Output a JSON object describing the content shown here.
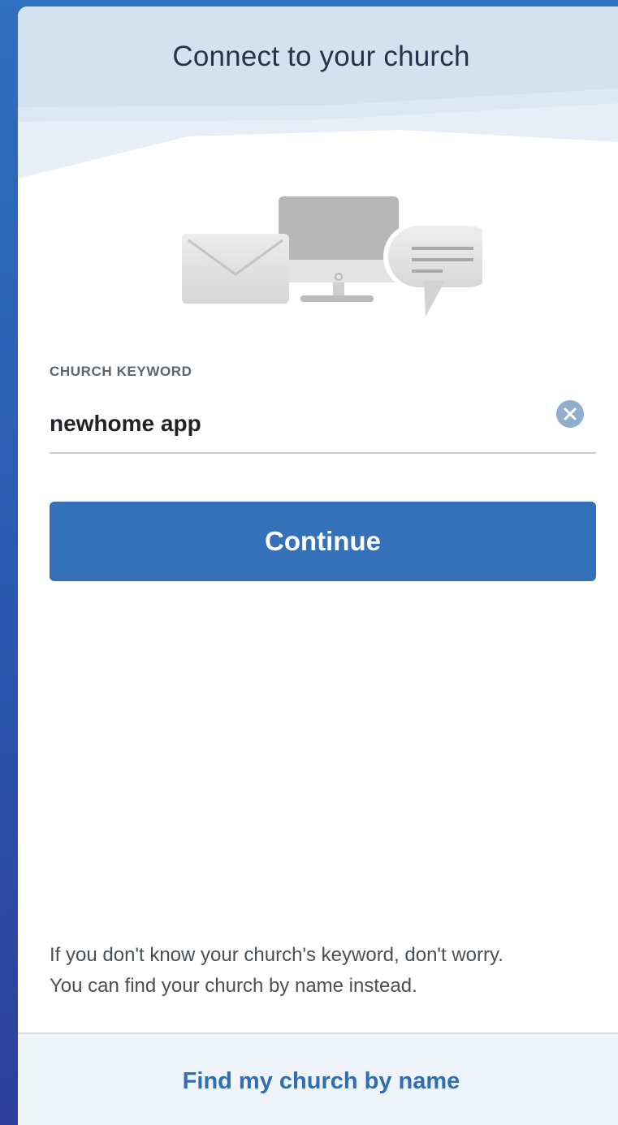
{
  "header": {
    "title": "Connect to your church"
  },
  "illustration": {
    "icons": [
      "envelope-icon",
      "monitor-icon",
      "chat-bubble-icon"
    ]
  },
  "keyword_field": {
    "label": "CHURCH KEYWORD",
    "value": "newhome app",
    "clear_icon": "clear-x-icon"
  },
  "actions": {
    "continue_label": "Continue"
  },
  "help": {
    "line1": "If you don't know your church's keyword, don't worry.",
    "line2": "You can find your church by name instead."
  },
  "footer": {
    "find_by_name_label": "Find my church by name"
  },
  "colors": {
    "accent": "#3471b8",
    "link": "#2f6db5",
    "background_gradient_top": "#2f6fbf",
    "background_gradient_bottom": "#2c3f9c",
    "header_band": "#d3e2f0",
    "footer_band": "#eef4fa"
  }
}
